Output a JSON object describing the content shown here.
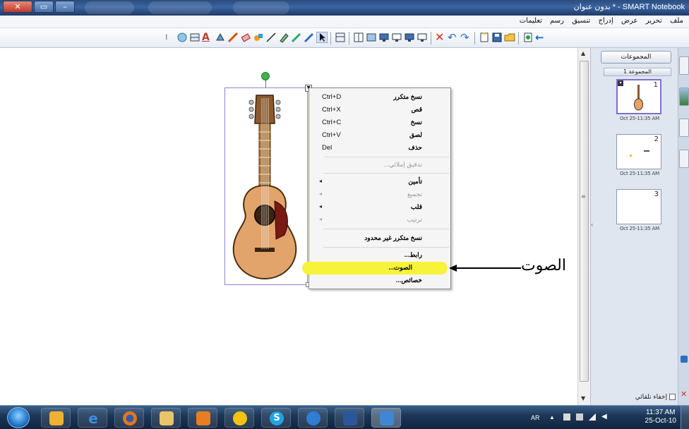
{
  "window": {
    "title": "SMART Notebook - * بدون عنوان"
  },
  "menubar": {
    "items": [
      "ملف",
      "تحرير",
      "عرض",
      "إدراج",
      "تنسيق",
      "رسم",
      "تعليمات"
    ]
  },
  "sidepanel": {
    "groups_button": "المجموعات",
    "group_label": "المجموعة 1",
    "pages": [
      {
        "number": "1",
        "date": "Oct 25-11:35 AM"
      },
      {
        "number": "2",
        "date": "Oct 25-11:35 AM"
      },
      {
        "number": "3",
        "date": "Oct 25-11:35 AM"
      }
    ],
    "auto_hide": "إخفاء تلقائي"
  },
  "context_menu": {
    "items": [
      {
        "label": "نسخ متكرر",
        "shortcut": "Ctrl+D"
      },
      {
        "label": "قص",
        "shortcut": "Ctrl+X"
      },
      {
        "label": "نسخ",
        "shortcut": "Ctrl+C"
      },
      {
        "label": "لصق",
        "shortcut": "Ctrl+V"
      },
      {
        "label": "حذف",
        "shortcut": "Del"
      },
      {
        "label": "تدقيق إملائي..."
      },
      {
        "label": "تأمين"
      },
      {
        "label": "تجميع"
      },
      {
        "label": "قلب"
      },
      {
        "label": "ترتيب"
      },
      {
        "label": "نسخ متكرر غير محدود"
      },
      {
        "label": "رابط..."
      },
      {
        "label": "الصوت..."
      },
      {
        "label": "خصائص..."
      }
    ],
    "highlight_color": "#f7f23a"
  },
  "annotation": {
    "text": "الصوت"
  },
  "taskbar": {
    "language": "AR",
    "time": "11:37 AM",
    "date": "25-Oct-10"
  },
  "colors": {
    "selection_border": "#8f84d6",
    "rotate_handle": "#3fb34f",
    "titlebar": "#2b4c7e"
  }
}
